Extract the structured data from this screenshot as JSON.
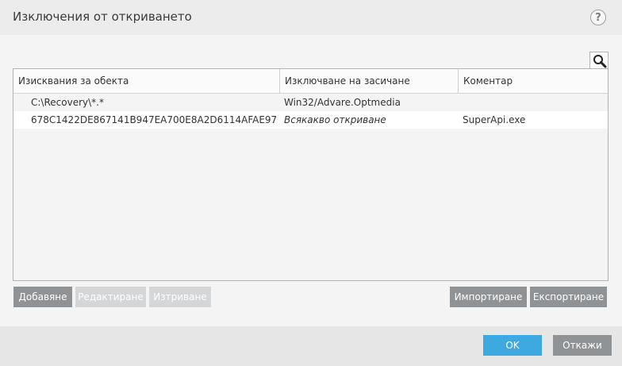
{
  "window": {
    "title": "Изключения от откриването",
    "help_label": "?"
  },
  "table": {
    "columns": [
      "Изисквания за обекта",
      "Изключване на засичане",
      "Коментар"
    ],
    "rows": [
      {
        "object": "C:\\Recovery\\*.*",
        "detection": "Win32/Advare.Optmedia",
        "comment": ""
      },
      {
        "object": "678C1422DE867141B947EA700E8A2D6114AFAE97",
        "detection": "Всякакво откриване",
        "comment": "SuperApi.exe"
      }
    ]
  },
  "actions": {
    "add": "Добавяне",
    "edit": "Редактиране",
    "delete": "Изтриване",
    "import": "Импортиране",
    "export": "Експортиране"
  },
  "footer": {
    "ok": "OK",
    "cancel": "Откажи"
  },
  "colors": {
    "accent": "#3ea8e0",
    "button": "#909396",
    "button_disabled": "#d5d6d7"
  }
}
